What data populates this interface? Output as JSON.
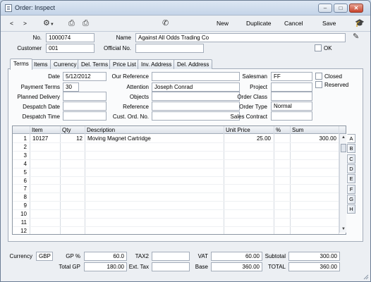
{
  "window": {
    "title": "Order: Inspect"
  },
  "toolbar": {
    "back": "<",
    "forward": ">",
    "new_label": "New",
    "duplicate_label": "Duplicate",
    "cancel_label": "Cancel",
    "save_label": "Save"
  },
  "header": {
    "no_label": "No.",
    "no_value": "1000074",
    "name_label": "Name",
    "name_value": "Against All Odds Trading Co",
    "customer_label": "Customer",
    "customer_value": "001",
    "official_label": "Official No.",
    "official_value": "",
    "ok_label": "OK"
  },
  "tabs": [
    "Terms",
    "Items",
    "Currency",
    "Del. Terms",
    "Price List",
    "Inv. Address",
    "Del. Address"
  ],
  "terms": {
    "date_label": "Date",
    "date_value": "5/12/2012",
    "payment_label": "Payment Terms",
    "payment_value": "30",
    "planned_label": "Planned Delivery",
    "planned_value": "",
    "despatch_date_label": "Despatch Date",
    "despatch_date_value": "",
    "despatch_time_label": "Despatch Time",
    "despatch_time_value": "",
    "our_ref_label": "Our Reference",
    "our_ref_value": "",
    "attention_label": "Attention",
    "attention_value": "Joseph Conrad",
    "objects_label": "Objects",
    "objects_value": "",
    "reference_label": "Reference",
    "reference_value": "",
    "cust_ord_label": "Cust. Ord. No.",
    "cust_ord_value": "",
    "salesman_label": "Salesman",
    "salesman_value": "FF",
    "project_label": "Project",
    "project_value": "",
    "order_class_label": "Order Class",
    "order_class_value": "",
    "order_type_label": "Order Type",
    "order_type_value": "Normal",
    "sales_contract_label": "Sales Contract",
    "sales_contract_value": "",
    "closed_label": "Closed",
    "reserved_label": "Reserved"
  },
  "grid": {
    "columns": [
      "Item",
      "Qty",
      "Description",
      "Unit Price",
      "%",
      "Sum"
    ],
    "rows": [
      {
        "n": "1",
        "item": "10127",
        "qty": "12",
        "desc": "Moving Magnet Cartridge",
        "price": "25.00",
        "pct": "",
        "sum": "300.00"
      },
      {
        "n": "2"
      },
      {
        "n": "3"
      },
      {
        "n": "4"
      },
      {
        "n": "5"
      },
      {
        "n": "6"
      },
      {
        "n": "7"
      },
      {
        "n": "8"
      },
      {
        "n": "9"
      },
      {
        "n": "10"
      },
      {
        "n": "11"
      },
      {
        "n": "12"
      }
    ],
    "side_tabs": [
      "A",
      "B",
      "C",
      "D",
      "E",
      "F",
      "G",
      "H"
    ]
  },
  "footer": {
    "currency_label": "Currency",
    "currency_value": "GBP",
    "gp_label": "GP %",
    "gp_value": "60.0",
    "total_gp_label": "Total GP",
    "total_gp_value": "180.00",
    "tax2_label": "TAX2",
    "tax2_value": "",
    "ext_tax_label": "Ext. Tax",
    "ext_tax_value": "",
    "vat_label": "VAT",
    "vat_value": "60.00",
    "base_label": "Base",
    "base_value": "360.00",
    "subtotal_label": "Subtotal",
    "subtotal_value": "300.00",
    "total_label": "TOTAL",
    "total_value": "360.00"
  }
}
